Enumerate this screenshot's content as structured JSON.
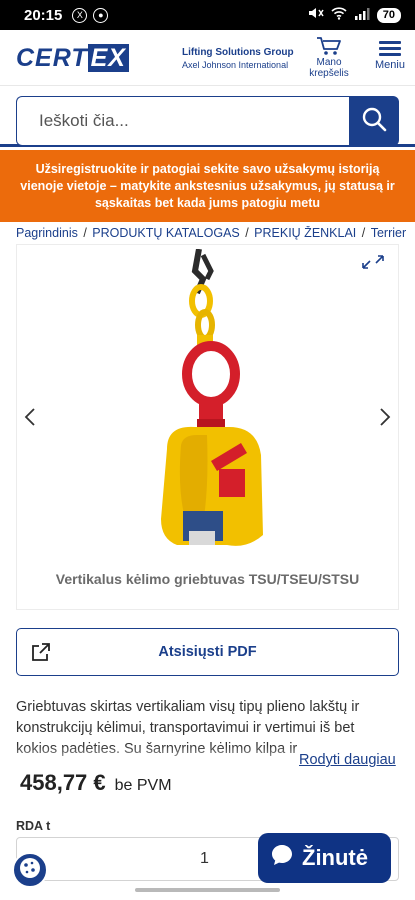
{
  "status_bar": {
    "time": "20:15",
    "battery": "70"
  },
  "header": {
    "logo_main": "CERTEX",
    "logo_line1": "Lifting Solutions Group",
    "logo_line2": "Axel Johnson International",
    "cart_label_1": "Mano",
    "cart_label_2": "krepšelis",
    "menu_label": "Meniu",
    "brand_color": "#1b3f8b"
  },
  "search": {
    "placeholder": "Ieškoti čia..."
  },
  "banner": {
    "text": "Užsiregistruokite ir patogiai sekite savo užsakymų istoriją vienoje vietoje – matykite ankstesnius užsakymus, jų statusą ir sąskaitas bet kada jums patogiu metu",
    "color": "#ec6b0c"
  },
  "breadcrumb": {
    "items": [
      "Pagrindinis",
      "PRODUKTŲ KATALOGAS",
      "PREKIŲ ŽENKLAI",
      "Terrier"
    ]
  },
  "product": {
    "caption": "Vertikalus kėlimo griebtuvas TSU/TSEU/STSU"
  },
  "download": {
    "label": "Atsisiųsti PDF"
  },
  "description": {
    "text": "Griebtuvas skirtas vertikaliam visų tipų plieno lakštų ir konstrukcijų kėlimui, transportavimui ir vertimui iš bet kokios padėties. Su šarnyrine kėlimo kilpa ir",
    "read_more": "Rodyti daugiau"
  },
  "pricing": {
    "price": "458,77 €",
    "vat_note": "be PVM"
  },
  "quantity": {
    "label": "RDA t",
    "value": "1"
  },
  "chat": {
    "label": "Žinutė"
  }
}
